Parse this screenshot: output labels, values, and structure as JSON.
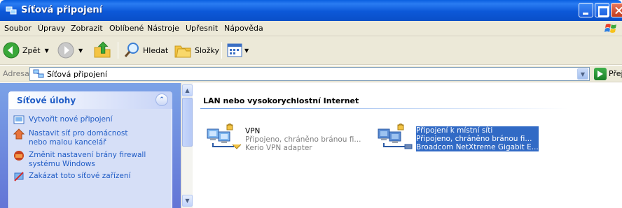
{
  "window": {
    "title": "Síťová připojení"
  },
  "menu": [
    "Soubor",
    "Úpravy",
    "Zobrazit",
    "Oblíbené",
    "Nástroje",
    "Upřesnit",
    "Nápověda"
  ],
  "toolbar": {
    "back": "Zpět",
    "search": "Hledat",
    "folders": "Složky"
  },
  "address": {
    "label": "Adresa",
    "value": "Síťová připojení",
    "go": "Přejít"
  },
  "tasks": {
    "header": "Síťové úlohy",
    "items": [
      "Vytvořit nové připojení",
      "Nastavit síť pro domácnost nebo malou kancelář",
      "Změnit nastavení brány firewall systému Windows",
      "Zakázat toto síťové zařízení"
    ]
  },
  "content": {
    "group_title": "LAN nebo vysokorychlostní Internet",
    "connections": [
      {
        "name": "VPN",
        "status": "Připojeno, chráněno bránou fi...",
        "device": "Kerio VPN adapter",
        "selected": false
      },
      {
        "name": "Připojení k místní síti",
        "status": "Připojeno, chráněno bránou fi...",
        "device": "Broadcom NetXtreme Gigabit E...",
        "selected": true
      }
    ]
  },
  "colors": {
    "titlebar": "#0a58d8",
    "taskpane": "#7ba2e7",
    "selection": "#316ac5"
  }
}
